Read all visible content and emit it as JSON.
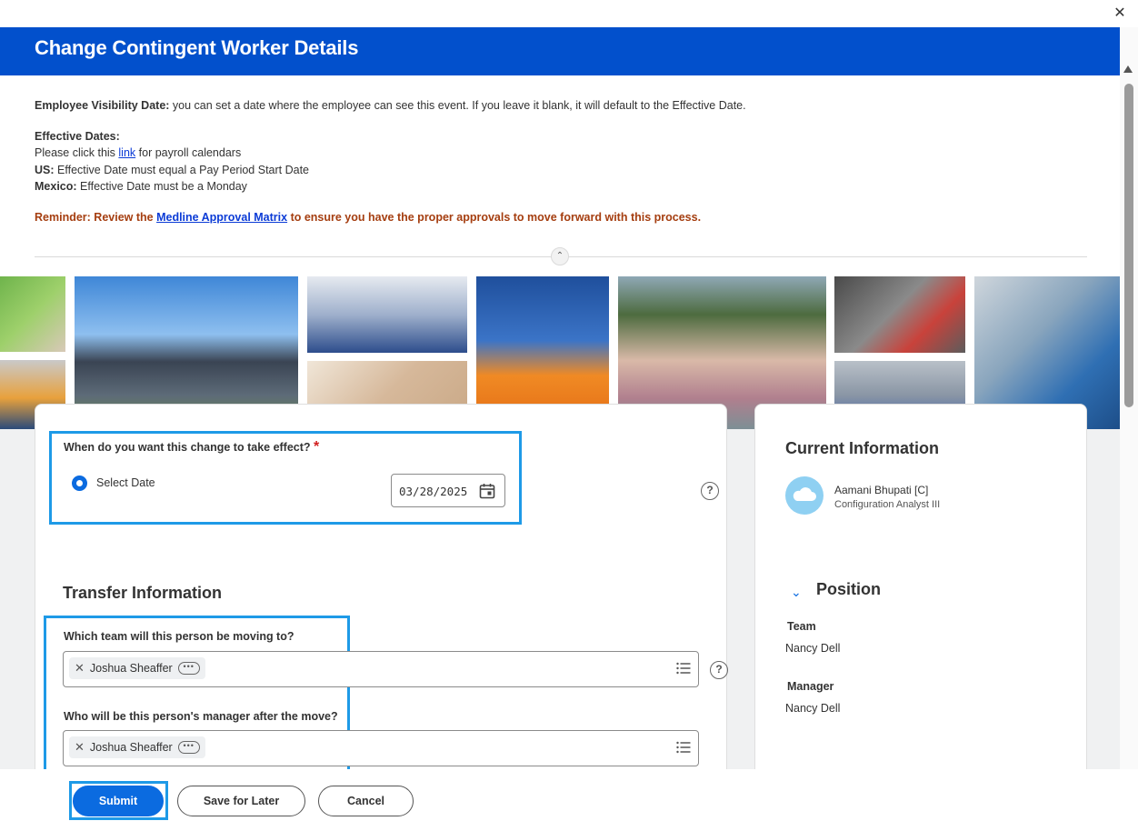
{
  "header": {
    "title": "Change Contingent Worker Details"
  },
  "icons": {
    "close": "✕",
    "collapse": "⌃",
    "help": "?",
    "remove": "✕",
    "more": "•••",
    "chevron_down": "⌄"
  },
  "intro": {
    "visibility_label": "Employee Visibility Date:",
    "visibility_text": "you can set a date where the employee can see this event. If you leave it blank, it will default to the Effective Date.",
    "effective_heading": "Effective Dates:",
    "payroll_pre": "Please click this ",
    "payroll_link": "link",
    "payroll_post": " for payroll calendars",
    "us_label": "US:",
    "us_text": "Effective Date must equal a Pay Period Start Date",
    "mexico_label": "Mexico:",
    "mexico_text": "Effective Date must be a Monday",
    "reminder_pre": "Reminder: Review the ",
    "reminder_link": "Medline Approval Matrix",
    "reminder_post": " to ensure you have the proper approvals to move forward with this process."
  },
  "form": {
    "effective_question": "When do you want this change to take effect?",
    "required_mark": "*",
    "radio_label": "Select Date",
    "date_value": "03/28/2025",
    "section_title": "Transfer Information",
    "team_question": "Which team will this person be moving to?",
    "team_value": "Joshua Sheaffer",
    "manager_question": "Who will be this person's manager after the move?",
    "manager_value": "Joshua Sheaffer"
  },
  "current": {
    "title": "Current Information",
    "name": "Aamani Bhupati [C]",
    "role": "Configuration Analyst III",
    "position_title": "Position",
    "team_label": "Team",
    "team_value": "Nancy Dell",
    "manager_label": "Manager",
    "manager_value": "Nancy Dell"
  },
  "footer": {
    "submit": "Submit",
    "save": "Save for Later",
    "cancel": "Cancel"
  },
  "colors": {
    "header_blue": "#0250cc",
    "primary_button": "#0b6be0",
    "highlight_box": "#1e9ae7",
    "reminder_text": "#a53e10",
    "link": "#0b3bd6"
  }
}
